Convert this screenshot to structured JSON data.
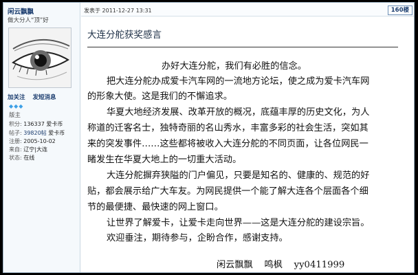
{
  "user": {
    "name": "闲云飘飘",
    "signature": "做大分人“顶”好",
    "actions": [
      "加关注",
      "发短消息"
    ],
    "rank": "版主",
    "stats": [
      {
        "label": "积分:",
        "value": "136337",
        "extra": "爱卡币"
      },
      {
        "label": "帖子:",
        "value": "39820帖",
        "extra": "爱卡币"
      },
      {
        "label": "注册:",
        "value": "2005-10-02",
        "extra": ""
      },
      {
        "label": "来自:",
        "value": "辽宁|大连",
        "extra": ""
      },
      {
        "label": "状态:",
        "value": "在线",
        "extra": ""
      }
    ]
  },
  "post": {
    "time": "发表于  2011-12-27  13:31",
    "floor": "160楼",
    "title": "大连分舵获奖感言",
    "lines": [
      "办好大连分舵，我们有必胜的信念。",
      "把大连分舵办成爱卡汽车网的一流地方论坛，使之成为爱卡汽车网",
      "的形象大使。这是我们的不懈追求。",
      "华夏大地经济发展、改革开放的概况，底蕴丰厚的历史文化，为人",
      "称道的迁客名士，独特奇丽的名山秀水，丰富多彩的社会生活，突如其",
      "来的突发事件……这些都将被收入大连分舵的不同页面，让各位网民一",
      "睹发生在华夏大地上的一切重大活动。",
      "大连分舵摒弃狭隘的门户偏见，只要是知名的、健康的、规范的好",
      "贴，都会展示给广大车友。为网民提供一个能了解大连各个层面各个细",
      "节的最便捷、最快速的网上窗口。",
      "让世界了解爱卡，让爱卡走向世界——这是大连分舵的建设宗旨。",
      "欢迎垂注，期待参与，企盼合作，感谢支持。"
    ],
    "signoff": "闲云飘飘    鸣枫    yy0411999"
  }
}
